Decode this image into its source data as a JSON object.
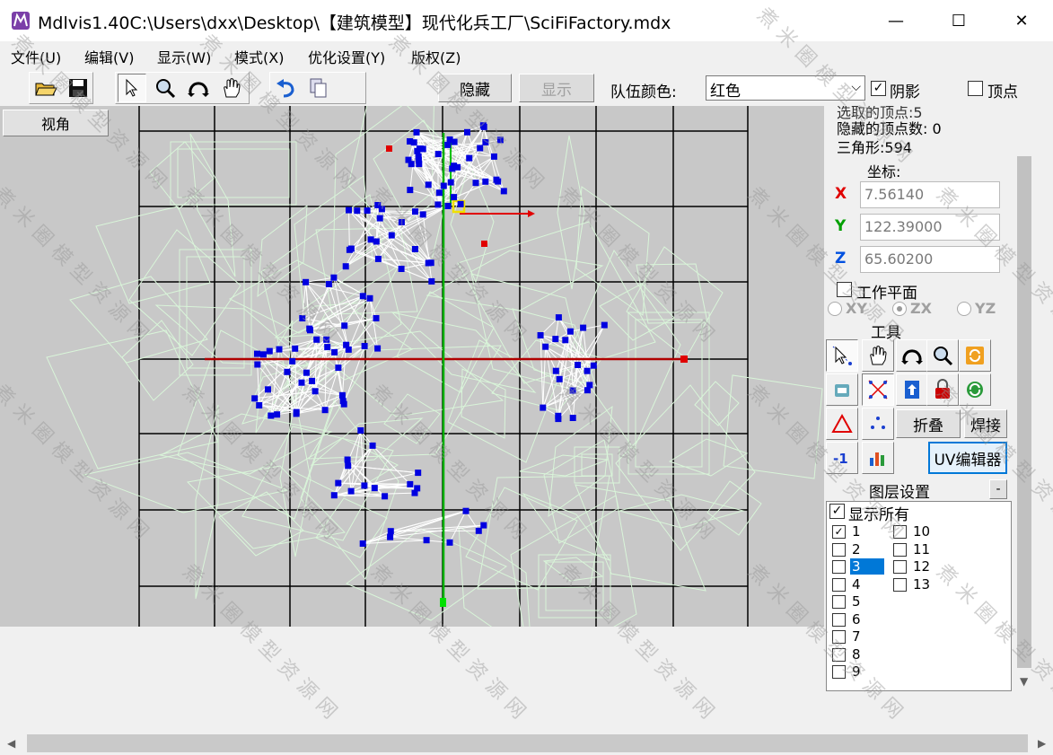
{
  "window": {
    "title": "Mdlvis1.40C:\\Users\\dxx\\Desktop\\【建筑模型】现代化兵工厂\\SciFiFactory.mdx",
    "minimize_glyph": "—",
    "maximize_glyph": "☐",
    "close_glyph": "✕"
  },
  "menu": [
    "文件(U)",
    "编辑(V)",
    "显示(W)",
    "模式(X)",
    "优化设置(Y)",
    "版权(Z)"
  ],
  "toolbar": {
    "icons": [
      "open-folder-icon",
      "save-icon",
      "select-arrow-icon",
      "zoom-icon",
      "rotate-icon",
      "pan-hand-icon",
      "undo-icon",
      "copy-icon"
    ],
    "hide_label": "隐藏",
    "show_label": "显示",
    "team_color_label": "队伍颜色:",
    "team_color_value": "红色",
    "shadow_label": "阴影",
    "shadow_checked": true,
    "vertex_label": "顶点",
    "vertex_checked": false
  },
  "view_tab_label": "视角",
  "panel": {
    "selected_vertices_partial": "选取的顶点:5",
    "hidden_vertices": "隐藏的顶点数: 0",
    "triangles": "三角形:594",
    "coords_title": "坐标:",
    "x_label": "X",
    "x_value": "7.56140",
    "y_label": "Y",
    "y_value": "122.39000",
    "z_label": "Z",
    "z_value": "65.60200",
    "work_plane_label": "工作平面",
    "planes": [
      "XY",
      "ZX",
      "YZ"
    ],
    "selected_plane": "ZX",
    "tools_title": "工具",
    "fold_label": "折叠",
    "weld_label": "焊接",
    "uv_editor_label": "UV编辑器",
    "layer_settings_label": "图层设置",
    "layer_collapse": "-",
    "show_all_label": "显示所有",
    "show_all_checked": true,
    "layers_left": [
      "1",
      "2",
      "3",
      "4",
      "5",
      "6",
      "7",
      "8",
      "9"
    ],
    "layers_right": [
      "10",
      "11",
      "12",
      "13"
    ],
    "layer_checked": "1",
    "layer_highlighted": "3"
  },
  "watermark_text": "煮米圈模型资源网",
  "colors": {
    "viewport_bg": "#c8c8c8",
    "wireframe": "#d9f5d9",
    "vertex": "#0000e0",
    "grid": "#000000",
    "selection_highlight": "#0078d7"
  }
}
